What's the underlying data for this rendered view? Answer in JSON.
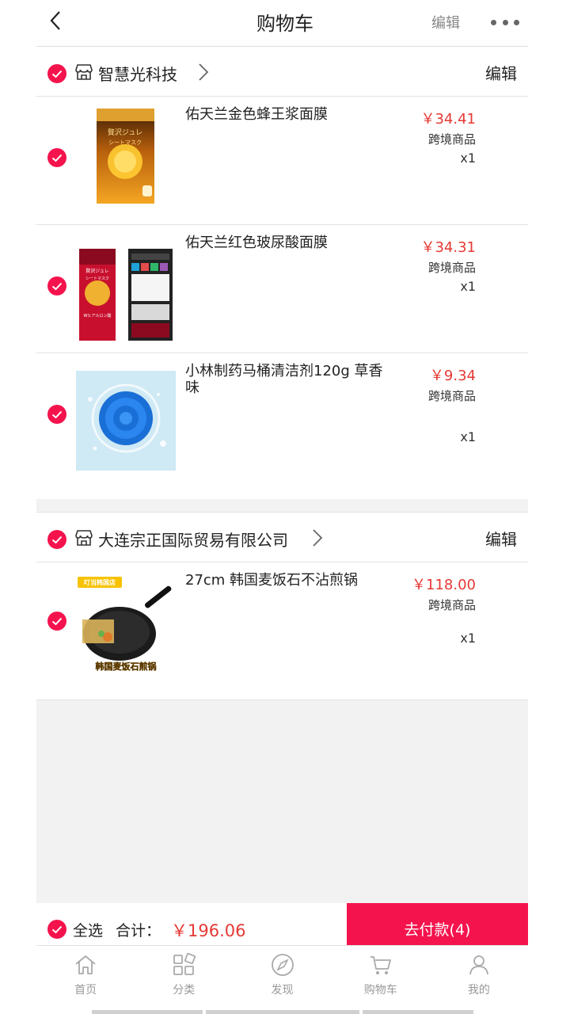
{
  "header": {
    "title": "购物车",
    "edit": "编辑"
  },
  "shops": [
    {
      "name": "智慧光科技",
      "edit": "编辑",
      "items": [
        {
          "title": "佑天兰金色蜂王浆面膜",
          "price": "￥34.41",
          "tag": "跨境商品",
          "qty": "x1"
        },
        {
          "title": "佑天兰红色玻尿酸面膜",
          "price": "￥34.31",
          "tag": "跨境商品",
          "qty": "x1"
        },
        {
          "title": "小林制药马桶清洁剂120g 草香味",
          "price": "￥9.34",
          "tag": "跨境商品",
          "qty": "x1"
        }
      ]
    },
    {
      "name": "大连宗正国际贸易有限公司",
      "edit": "编辑",
      "items": [
        {
          "title": "27cm 韩国麦饭石不沾煎锅",
          "price": "￥118.00",
          "tag": "跨境商品",
          "qty": "x1"
        }
      ]
    }
  ],
  "product_images": {
    "mask_gold": {
      "box_text_1": "贅沢ジュレ",
      "box_text_2": "シートマスク"
    },
    "mask_red": {
      "box_text_1": "贅沢ジュレ",
      "box_text_2": "シートマスク",
      "box_text_3": "Wヒアルロン酸"
    },
    "pan": {
      "badge": "叮当韩国店",
      "caption": "韩国麦饭石煎锅"
    }
  },
  "checkout": {
    "select_all": "全选",
    "total_label": "合计：",
    "total_value": "￥196.06",
    "pay_button": "去付款(4)"
  },
  "tabs": [
    {
      "label": "首页",
      "icon": "home-icon"
    },
    {
      "label": "分类",
      "icon": "category-icon"
    },
    {
      "label": "发现",
      "icon": "compass-icon"
    },
    {
      "label": "购物车",
      "icon": "cart-icon"
    },
    {
      "label": "我的",
      "icon": "user-icon"
    }
  ],
  "colors": {
    "accent": "#f5134d",
    "price": "#e53935",
    "background": "#f2f2f2"
  }
}
